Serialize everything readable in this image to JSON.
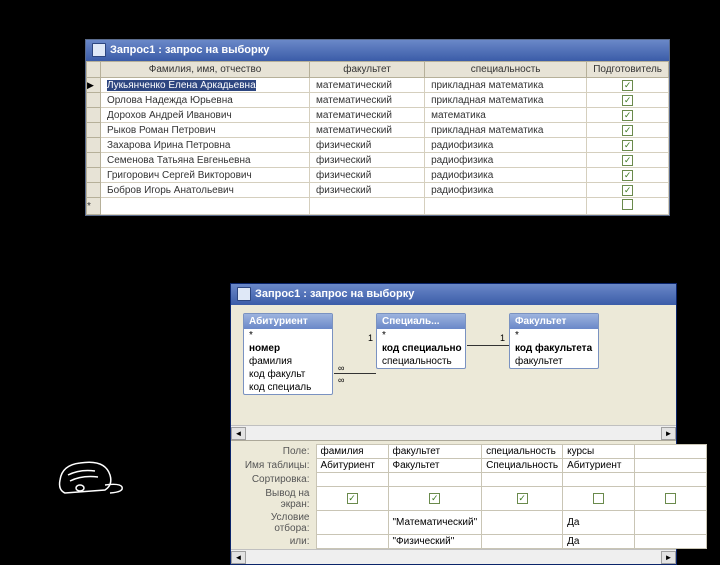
{
  "top_window": {
    "title": "Запрос1 : запрос на выборку",
    "columns": [
      "Фамилия, имя, отчество",
      "факультет",
      "специальность",
      "Подготовитель"
    ],
    "rows": [
      {
        "fio": "Лукьянченко Елена Аркадьевна",
        "fac": "математический",
        "spec": "прикладная математика",
        "chk": true,
        "current": true,
        "hilite": true
      },
      {
        "fio": "Орлова Надежда Юрьевна",
        "fac": "математический",
        "spec": "прикладная математика",
        "chk": true
      },
      {
        "fio": "Дорохов Андрей Иванович",
        "fac": "математический",
        "spec": "математика",
        "chk": true
      },
      {
        "fio": "Рыков Роман Петрович",
        "fac": "математический",
        "spec": "прикладная математика",
        "chk": true
      },
      {
        "fio": "Захарова Ирина Петровна",
        "fac": "физический",
        "spec": "радиофизика",
        "chk": true
      },
      {
        "fio": "Семенова Татьяна Евгеньевна",
        "fac": "физический",
        "spec": "радиофизика",
        "chk": true
      },
      {
        "fio": "Григорович Сергей Викторович",
        "fac": "физический",
        "spec": "радиофизика",
        "chk": true
      },
      {
        "fio": "Бобров Игорь Анатольевич",
        "fac": "физический",
        "spec": "радиофизика",
        "chk": true
      }
    ]
  },
  "bottom_window": {
    "title": "Запрос1 : запрос на выборку",
    "tables": {
      "t1": {
        "name": "Абитуриент",
        "fields": [
          "*",
          "номер",
          "фамилия",
          "код факульт",
          "код специаль"
        ]
      },
      "t2": {
        "name": "Специаль...",
        "fields": [
          "*",
          "код специально",
          "специальность"
        ]
      },
      "t3": {
        "name": "Факультет",
        "fields": [
          "*",
          "код факультета",
          "факультет"
        ]
      }
    },
    "relations": {
      "one": "1",
      "many": "∞"
    },
    "qbe_labels": {
      "field": "Поле:",
      "table": "Имя таблицы:",
      "sort": "Сортировка:",
      "show": "Вывод на экран:",
      "crit": "Условие отбора:",
      "or": "или:"
    },
    "qbe_cols": [
      {
        "field": "фамилия",
        "table": "Абитуриент",
        "show": true,
        "crit": "",
        "or": ""
      },
      {
        "field": "факультет",
        "table": "Факультет",
        "show": true,
        "crit": "\"Математический\"",
        "or": "\"Физический\""
      },
      {
        "field": "специальность",
        "table": "Специальность",
        "show": true,
        "crit": "",
        "or": ""
      },
      {
        "field": "курсы",
        "table": "Абитуриент",
        "show": false,
        "crit": "Да",
        "or": "Да"
      },
      {
        "field": "",
        "table": "",
        "show": false,
        "crit": "",
        "or": ""
      }
    ]
  }
}
